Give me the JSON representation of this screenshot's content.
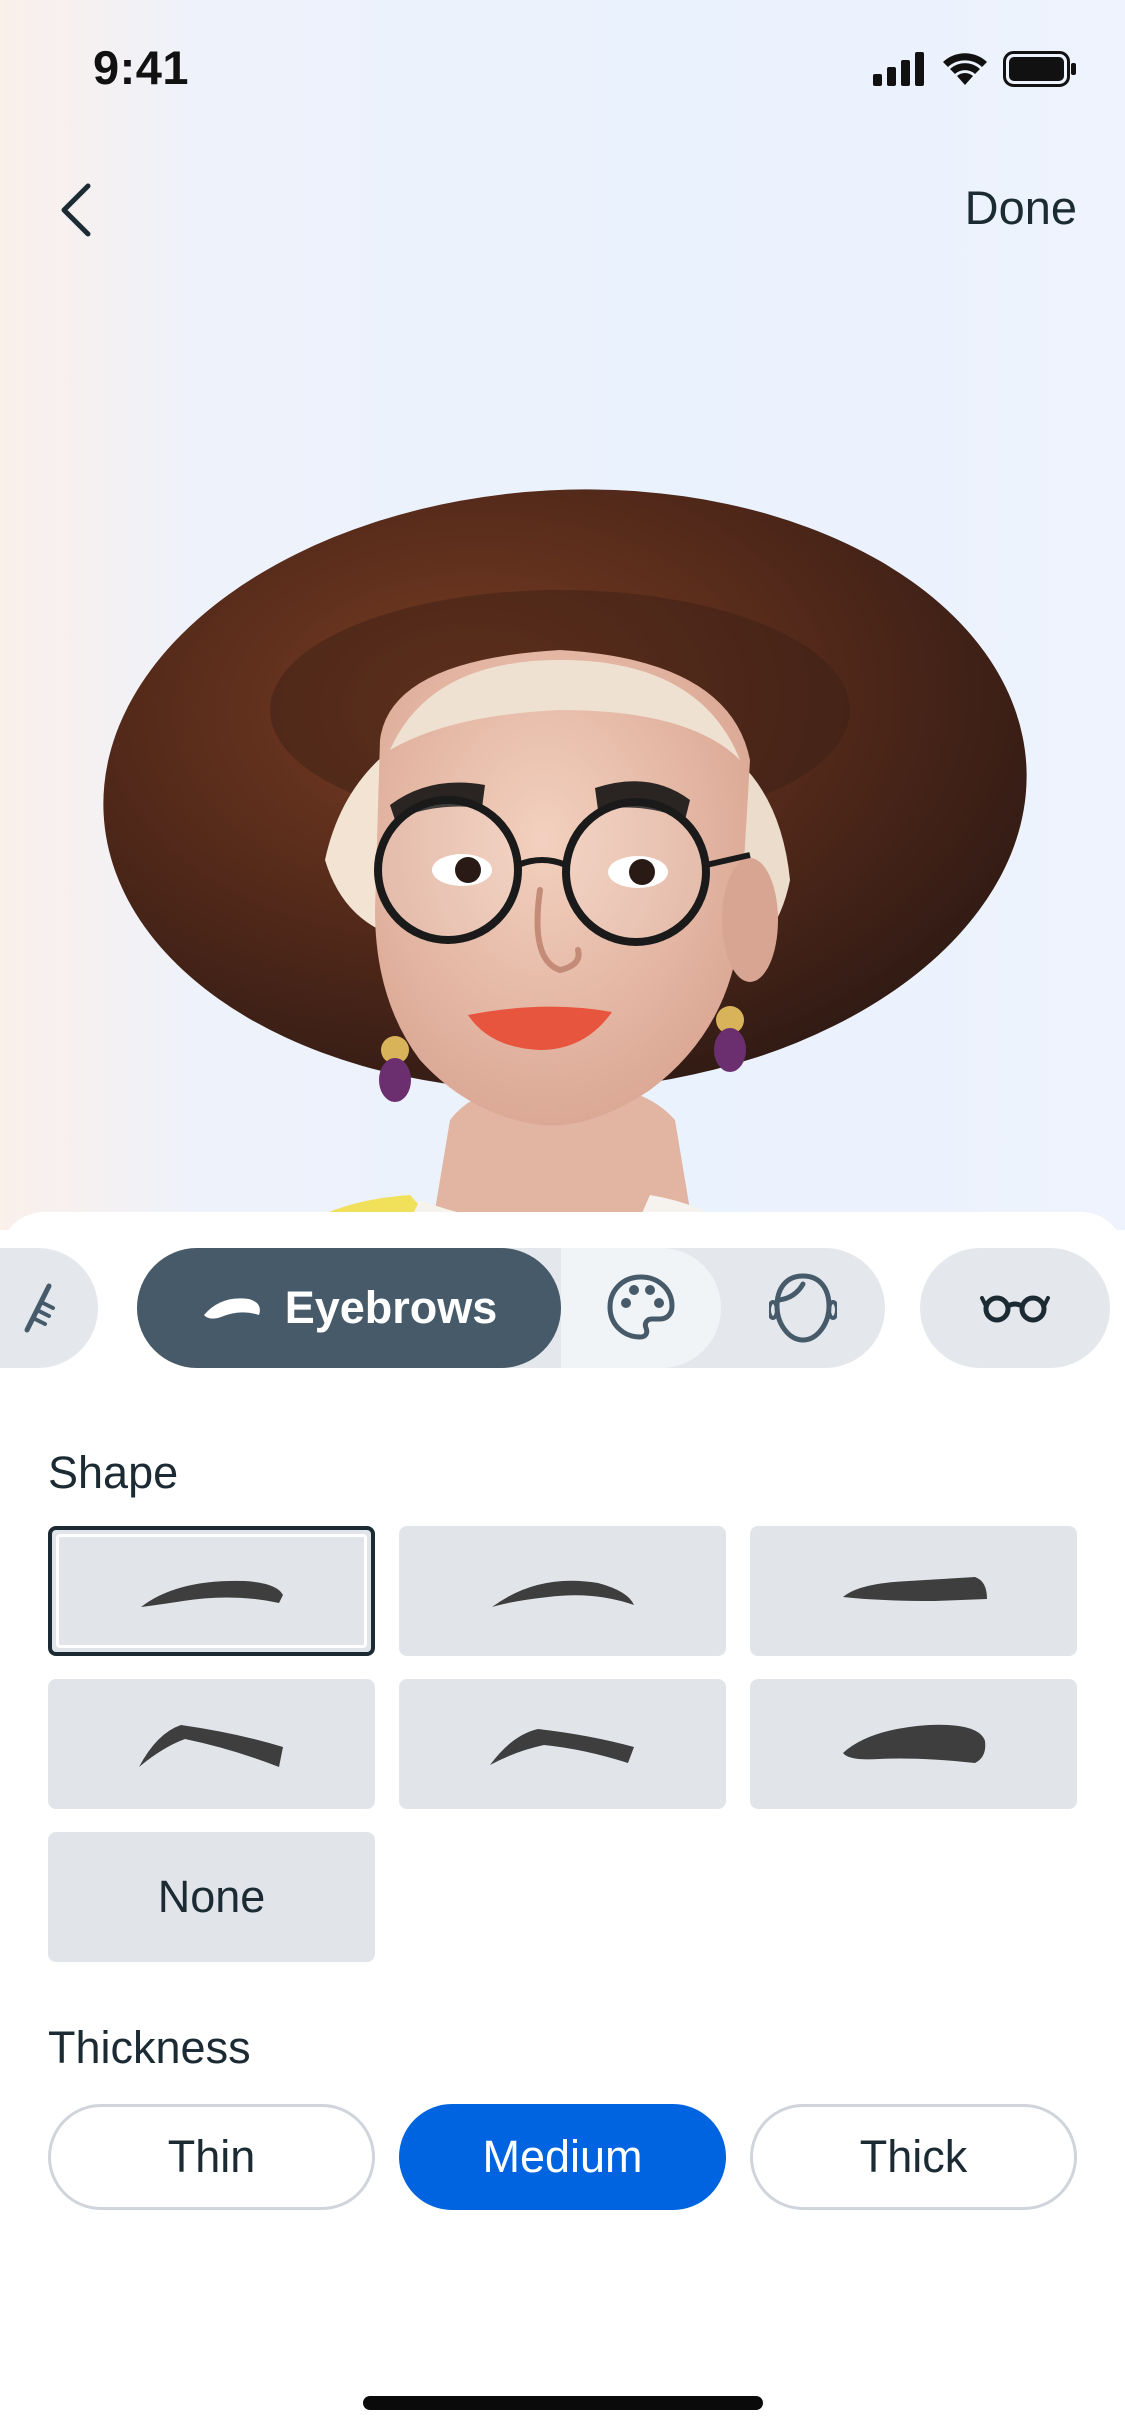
{
  "status_bar": {
    "time": "9:41"
  },
  "nav": {
    "done_label": "Done"
  },
  "tabs": [
    {
      "id": "prev",
      "icon": "hair-icon"
    },
    {
      "id": "eyebrows",
      "icon": "eyebrow-icon",
      "label": "Eyebrows",
      "selected": true
    },
    {
      "id": "color",
      "icon": "palette-icon"
    },
    {
      "id": "face",
      "icon": "face-icon"
    },
    {
      "id": "glasses",
      "icon": "glasses-icon"
    }
  ],
  "shape": {
    "title": "Shape",
    "options": [
      {
        "id": "shape-1",
        "selected": true
      },
      {
        "id": "shape-2"
      },
      {
        "id": "shape-3"
      },
      {
        "id": "shape-4"
      },
      {
        "id": "shape-5"
      },
      {
        "id": "shape-6"
      },
      {
        "id": "none",
        "label": "None"
      }
    ]
  },
  "thickness": {
    "title": "Thickness",
    "options": [
      "Thin",
      "Medium",
      "Thick"
    ],
    "selected": "Medium"
  },
  "colors": {
    "accent": "#0064e0",
    "tab_selected": "#465a69",
    "card_bg": "#e1e5ea"
  }
}
